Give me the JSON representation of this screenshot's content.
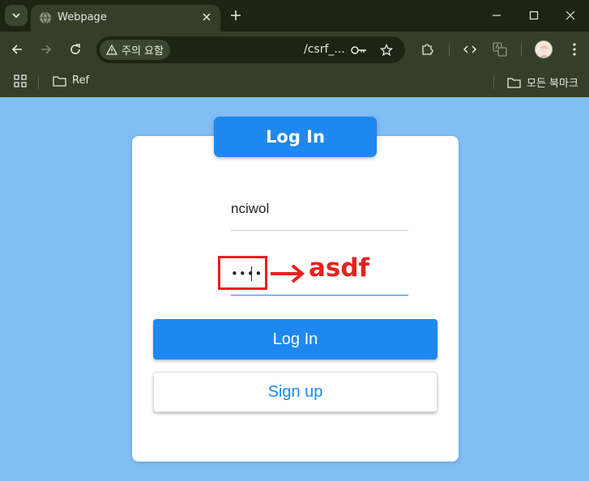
{
  "browser": {
    "tab": {
      "title": "Webpage"
    },
    "omnibox": {
      "security_label": "주의 요함",
      "url": "/csrf_..."
    },
    "bookmarks": {
      "folder_ref": "Ref",
      "all_bookmarks": "모든 북마크"
    }
  },
  "page": {
    "header_title": "Log In",
    "username_value": "nciwol",
    "password_mask": "••••",
    "login_button": "Log In",
    "signup_button": "Sign up",
    "annotation_text": "asdf"
  },
  "colors": {
    "page_background": "#7fbdf4",
    "accent": "#1e88f0",
    "annotation": "#e8211f",
    "chrome_dark": "#1c2413",
    "chrome_toolbar": "#343f2a"
  }
}
